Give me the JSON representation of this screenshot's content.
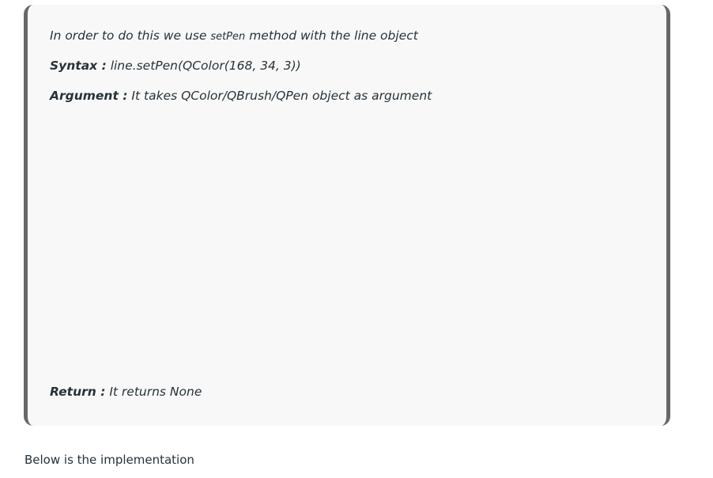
{
  "quote": {
    "intro_before": "In order to do this we use ",
    "intro_code": "setPen",
    "intro_after": " method with the line object",
    "syntax_label": "Syntax :",
    "syntax_value": " line.setPen(QColor(168, 34, 3))",
    "argument_label": "Argument :",
    "argument_value": " It takes QColor/QBrush/QPen object as argument",
    "return_label": "Return :",
    "return_value": " It returns None"
  },
  "below_text": "Below is the implementation",
  "colors": {
    "box_background": "#f8f8f8",
    "box_border": "#686868",
    "text": "#273239"
  }
}
